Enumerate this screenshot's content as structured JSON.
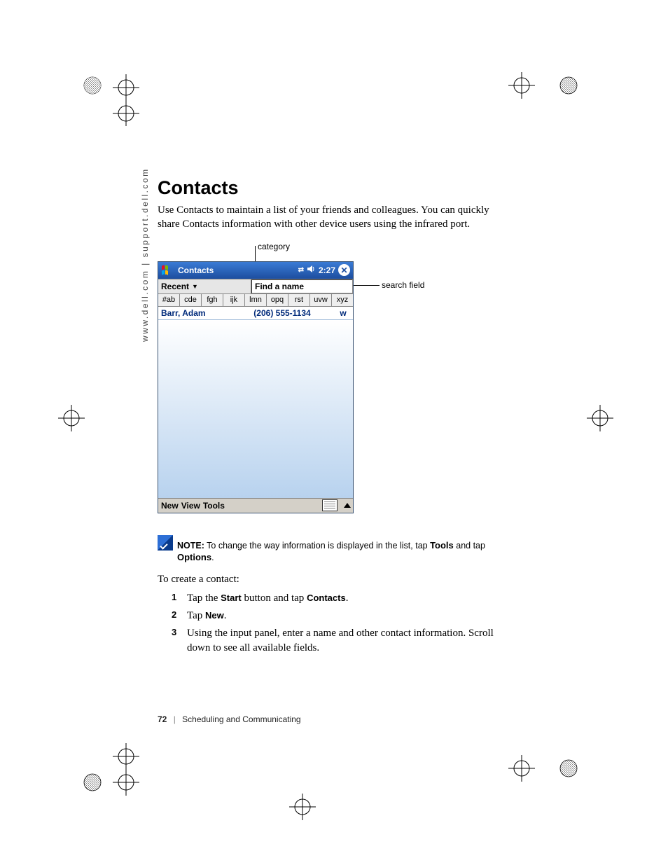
{
  "side_rail": "www.dell.com | support.dell.com",
  "heading": "Contacts",
  "intro": "Use Contacts to maintain a list of your friends and colleagues. You can quickly share Contacts information with other device users using the infrared port.",
  "figure": {
    "label_category": "category",
    "label_search": "search field",
    "title": "Contacts",
    "time": "2:27",
    "category_value": "Recent",
    "search_placeholder": "Find a name",
    "alpha_tabs": [
      "#ab",
      "cde",
      "fgh",
      "ijk",
      "lmn",
      "opq",
      "rst",
      "uvw",
      "xyz"
    ],
    "contact": {
      "name": "Barr, Adam",
      "phone": "(206) 555-1134",
      "type": "w"
    },
    "menu": {
      "new": "New",
      "view": "View",
      "tools": "Tools"
    },
    "icons": {
      "start": "windows-flag-icon",
      "connectivity": "connectivity-icon",
      "sound": "speaker-icon",
      "close": "close-icon",
      "keyboard": "keyboard-icon",
      "up": "up-arrow-icon"
    }
  },
  "note": {
    "label": "NOTE:",
    "text_before": " To change the way information is displayed in the list, tap ",
    "bold1": "Tools",
    "text_mid": " and tap ",
    "bold2": "Options",
    "text_after": "."
  },
  "create_intro": "To create a contact:",
  "steps": [
    {
      "pre": "Tap the ",
      "b1": "Start",
      "mid": " button and tap ",
      "b2": "Contacts",
      "post": "."
    },
    {
      "pre": "Tap ",
      "b1": "New",
      "mid": "",
      "b2": "",
      "post": "."
    },
    {
      "pre": "Using the input panel, enter a name and other contact information. Scroll down to see all available fields.",
      "b1": "",
      "mid": "",
      "b2": "",
      "post": ""
    }
  ],
  "footer": {
    "page": "72",
    "chapter": "Scheduling and Communicating"
  }
}
